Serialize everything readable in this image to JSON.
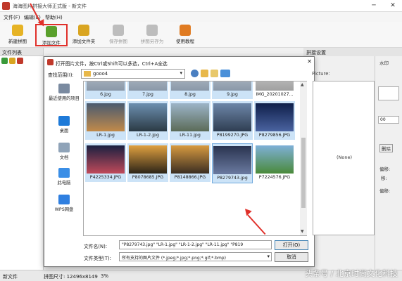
{
  "window": {
    "title": "海海图片拼接大师正式版 - 新文件",
    "minimize": "─",
    "close": "✕"
  },
  "menu": [
    {
      "label": "文件(F)"
    },
    {
      "label": "编辑(E)"
    },
    {
      "label": "帮助(H)"
    }
  ],
  "toolbar": [
    {
      "label": "新建拼图",
      "icon": "new-puzzle-icon",
      "color": "#e6b325",
      "enabled": true
    },
    {
      "label": "添加文件",
      "icon": "add-file-icon",
      "color": "#5aa02c",
      "enabled": true,
      "highlighted": true
    },
    {
      "label": "添加文件夹",
      "icon": "add-folder-icon",
      "color": "#d9a521",
      "enabled": true
    },
    {
      "label": "保存拼图",
      "icon": "save-icon",
      "color": "#bdbdbd",
      "enabled": false
    },
    {
      "label": "拼图另存为",
      "icon": "save-as-icon",
      "color": "#bdbdbd",
      "enabled": false
    },
    {
      "label": "使用教程",
      "icon": "help-icon",
      "color": "#e07b22",
      "enabled": true
    }
  ],
  "left_panel": {
    "header": "文件列表"
  },
  "right_panel": {
    "header": "拼接设置",
    "items": [
      {
        "label": "水印"
      },
      {
        "label": "00"
      },
      {
        "label": "删除"
      },
      {
        "label": "偏移:"
      },
      {
        "label": "移:"
      },
      {
        "label": "偏移:"
      }
    ]
  },
  "status": {
    "left": "新文件",
    "size_label": "拼图尺寸: 12496x8149",
    "zoom": "3%"
  },
  "watermark": "头条号 / 北京时尚文化科技",
  "dialog": {
    "title": "打开图片文件，按Ctrl或Shift可以多选，Ctrl+A全选",
    "look_in_label": "查找范围(I):",
    "look_in_value": "gooo4",
    "places": [
      {
        "label": "最近使用的项目",
        "icon": "recent-items-icon",
        "color": "#7a8aa0"
      },
      {
        "label": "桌面",
        "icon": "desktop-icon",
        "color": "#1e7ad8"
      },
      {
        "label": "文档",
        "icon": "documents-icon",
        "color": "#8fa3b8"
      },
      {
        "label": "此电脑",
        "icon": "this-pc-icon",
        "color": "#3a8ee6"
      },
      {
        "label": "WPS网盘",
        "icon": "wps-cloud-icon",
        "color": "#2f7fe0"
      }
    ],
    "files": [
      {
        "name": "6.jpg",
        "selected": true,
        "color1": "#c8cfd8",
        "color2": "#8a98a8"
      },
      {
        "name": "7.jpg",
        "selected": true,
        "color1": "#c8cfd8",
        "color2": "#8a98a8"
      },
      {
        "name": "8.jpg",
        "selected": true,
        "color1": "#c8cfd8",
        "color2": "#8a98a8"
      },
      {
        "name": "9.jpg",
        "selected": true,
        "color1": "#c8cfd8",
        "color2": "#8a98a8"
      },
      {
        "name": "IMG_20201027...",
        "selected": false,
        "color1": "#d8d8d8",
        "color2": "#a0a0a0"
      },
      {
        "name": "LR-1.jpg",
        "selected": true,
        "color1": "#4a5a70",
        "color2": "#c28a4a"
      },
      {
        "name": "LR-1-2.jpg",
        "selected": true,
        "color1": "#6c8fb0",
        "color2": "#2b3a44"
      },
      {
        "name": "LR-11.jpg",
        "selected": true,
        "color1": "#9cb4c8",
        "color2": "#5b6b58"
      },
      {
        "name": "P8199270.JPG",
        "selected": true,
        "color1": "#6d86a8",
        "color2": "#2f3e52"
      },
      {
        "name": "P8279856.JPG",
        "selected": true,
        "color1": "#0f1f4a",
        "color2": "#4a63a0"
      },
      {
        "name": "P4225334.JPG",
        "selected": true,
        "color1": "#1a2040",
        "color2": "#c04a5a"
      },
      {
        "name": "P8078685.JPG",
        "selected": true,
        "color1": "#e0a040",
        "color2": "#2c2418"
      },
      {
        "name": "P8148866.JPG",
        "selected": true,
        "color1": "#d89a40",
        "color2": "#3a2e22"
      },
      {
        "name": "P8279743.jpg",
        "selected": true,
        "color1": "#2a3450",
        "color2": "#6a7aa0"
      },
      {
        "name": "P7224576.JPG",
        "selected": false,
        "color1": "#7fb0d8",
        "color2": "#4a8a3a"
      }
    ],
    "preview_label": "Picture:",
    "preview_text": "(None)",
    "filename_label": "文件名(N):",
    "filename_value": "\"P8279743.jpg\" \"LR-1.jpg\" \"LR-1-2.jpg\" \"LR-11.jpg\" \"P819",
    "filetype_label": "文件类型(T):",
    "filetype_value": "所有支持的图片文件 (*.jpeg;*.jpg;*.png;*.gif;*.bmp)",
    "open_button": "打开(O)",
    "cancel_button": "取消"
  }
}
